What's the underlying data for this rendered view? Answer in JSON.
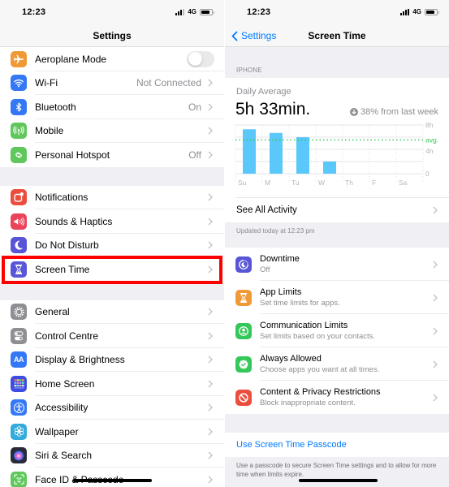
{
  "left": {
    "status": {
      "time": "12:23",
      "network": "4G"
    },
    "title": "Settings",
    "groups": [
      {
        "items": [
          {
            "label": "Aeroplane Mode",
            "icon": "airplane-icon",
            "color": "#f09a37",
            "toggle": "off"
          },
          {
            "label": "Wi-Fi",
            "detail": "Not Connected",
            "icon": "wifi-icon",
            "color": "#3478f6"
          },
          {
            "label": "Bluetooth",
            "detail": "On",
            "icon": "bluetooth-icon",
            "color": "#3478f6"
          },
          {
            "label": "Mobile",
            "icon": "antenna-icon",
            "color": "#5fc75c"
          },
          {
            "label": "Personal Hotspot",
            "detail": "Off",
            "icon": "hotspot-icon",
            "color": "#5fc75c"
          }
        ]
      },
      {
        "items": [
          {
            "label": "Notifications",
            "icon": "notifications-icon",
            "color": "#eb4e3d"
          },
          {
            "label": "Sounds & Haptics",
            "icon": "speaker-icon",
            "color": "#eb445a"
          },
          {
            "label": "Do Not Disturb",
            "icon": "moon-icon",
            "color": "#5856d6"
          },
          {
            "label": "Screen Time",
            "icon": "hourglass-icon",
            "color": "#5856d6",
            "highlighted": true
          }
        ]
      },
      {
        "items": [
          {
            "label": "General",
            "icon": "gear-icon",
            "color": "#8e8e93"
          },
          {
            "label": "Control Centre",
            "icon": "toggles-icon",
            "color": "#8e8e93"
          },
          {
            "label": "Display & Brightness",
            "icon": "text-size-icon",
            "color": "#3478f6",
            "glyph": "AA"
          },
          {
            "label": "Home Screen",
            "icon": "app-grid-icon",
            "color": "#3c4de0"
          },
          {
            "label": "Accessibility",
            "icon": "accessibility-icon",
            "color": "#3478f6"
          },
          {
            "label": "Wallpaper",
            "icon": "flower-icon",
            "color": "#35aadc"
          },
          {
            "label": "Siri & Search",
            "icon": "siri-icon",
            "color": "#2a2a3a"
          },
          {
            "label": "Face ID & Passcode",
            "icon": "face-id-icon",
            "color": "#5fc75c"
          }
        ]
      }
    ]
  },
  "right": {
    "status": {
      "time": "12:23",
      "network": "4G"
    },
    "back_label": "Settings",
    "title": "Screen Time",
    "section_header": "IPHONE",
    "daily_average_label": "Daily Average",
    "daily_average_value": "5h 33min.",
    "change_text": "38% from last week",
    "change_direction": "down",
    "see_all_label": "See All Activity",
    "updated_text": "Updated today at 12:23 pm",
    "options": [
      {
        "title": "Downtime",
        "subtitle": "Off",
        "icon": "downtime-icon",
        "color": "#5856d6"
      },
      {
        "title": "App Limits",
        "subtitle": "Set time limits for apps.",
        "icon": "hourglass-icon",
        "color": "#f09a37"
      },
      {
        "title": "Communication Limits",
        "subtitle": "Set limits based on your contacts.",
        "icon": "contact-icon",
        "color": "#34c759"
      },
      {
        "title": "Always Allowed",
        "subtitle": "Choose apps you want at all times.",
        "icon": "check-badge-icon",
        "color": "#34c759"
      },
      {
        "title": "Content & Privacy Restrictions",
        "subtitle": "Block inappropriate content.",
        "icon": "no-entry-icon",
        "color": "#eb4e3d"
      }
    ],
    "passcode_label": "Use Screen Time Passcode",
    "passcode_footer": "Use a passcode to secure Screen Time settings and to allow for more time when limits expire."
  },
  "colors": {
    "accent": "#007aff",
    "bar": "#5ac8fa",
    "average": "#34c759",
    "highlight": "#ff0000"
  },
  "chart_data": {
    "type": "bar",
    "title": "Daily Average",
    "categories": [
      "Su",
      "M",
      "Tu",
      "W",
      "Th",
      "F",
      "Sa"
    ],
    "values": [
      7.3,
      6.7,
      6.0,
      2.0,
      0,
      0,
      0
    ],
    "unit": "hours",
    "average": 5.55,
    "average_label": "avg.",
    "ylim": [
      0,
      8
    ],
    "yticks": [
      {
        "value": 8,
        "label": "8h"
      },
      {
        "value": 4,
        "label": "4h"
      },
      {
        "value": 0,
        "label": "0"
      }
    ],
    "gridlines": [
      0,
      2,
      4,
      6,
      8
    ],
    "grid": true,
    "legend": "none"
  }
}
